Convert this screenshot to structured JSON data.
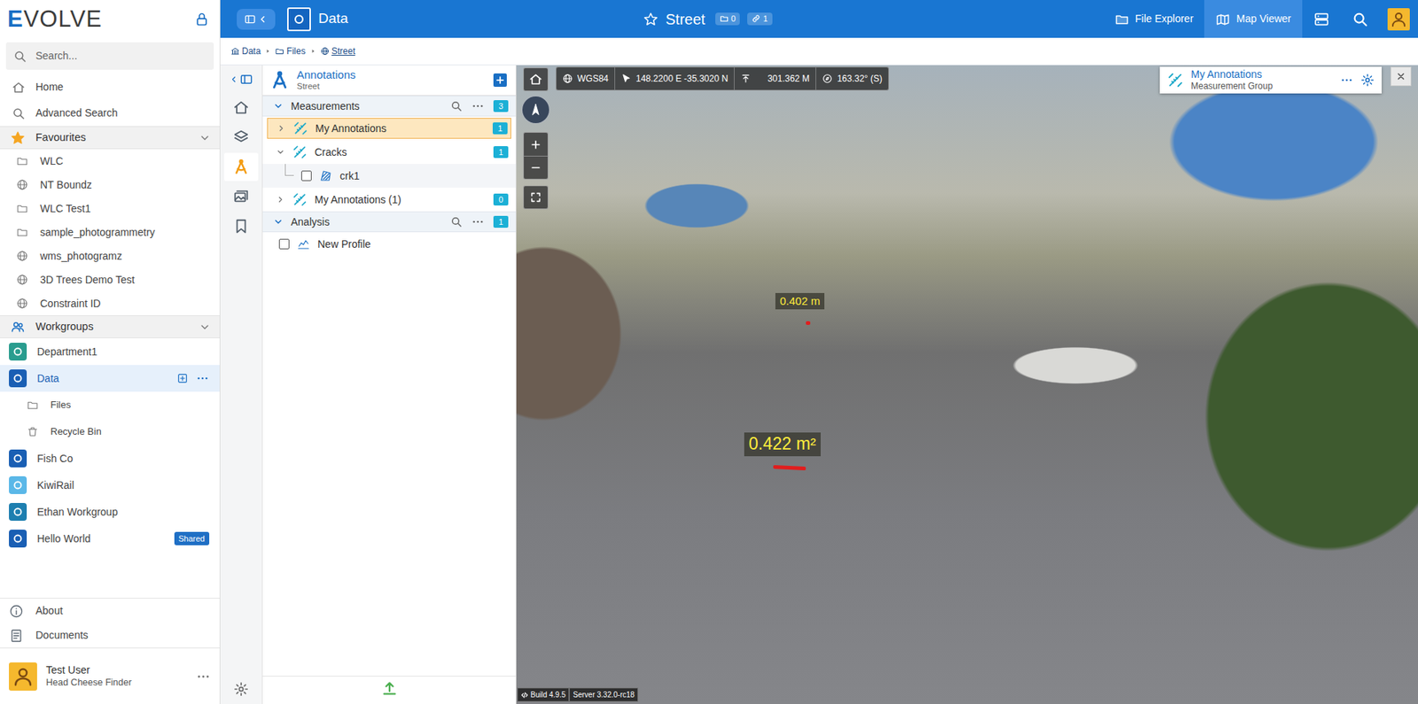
{
  "brand": {
    "logo": "EVOLVE"
  },
  "sidebar": {
    "search": {
      "placeholder": "Search..."
    },
    "nav": [
      {
        "label": "Home",
        "kind": "home"
      },
      {
        "label": "Advanced Search",
        "kind": "search"
      }
    ],
    "favourites": {
      "title": "Favourites",
      "expanded": true,
      "items": [
        {
          "label": "WLC",
          "kind": "folder"
        },
        {
          "label": "NT Boundz",
          "kind": "globe"
        },
        {
          "label": "WLC Test1",
          "kind": "folder"
        },
        {
          "label": "sample_photogrammetry",
          "kind": "folder"
        },
        {
          "label": "wms_photogramz",
          "kind": "globe"
        },
        {
          "label": "3D Trees Demo Test",
          "kind": "globe"
        },
        {
          "label": "Constraint ID",
          "kind": "globe"
        }
      ]
    },
    "workgroups": {
      "title": "Workgroups",
      "expanded": true,
      "items": [
        {
          "label": "Department1",
          "kind": "group",
          "color": "#2a9d8f",
          "selected": false
        },
        {
          "label": "Data",
          "kind": "group",
          "color": "#1a5fb4",
          "selected": true
        },
        {
          "label": "Files",
          "kind": "folder",
          "selected": false
        },
        {
          "label": "Recycle Bin",
          "kind": "bin",
          "selected": false
        },
        {
          "label": "Fish Co",
          "kind": "group",
          "color": "#1a5fb4",
          "selected": false
        },
        {
          "label": "KiwiRail",
          "kind": "group",
          "color": "#5bb8e8",
          "selected": false
        },
        {
          "label": "Ethan Workgroup",
          "kind": "group",
          "color": "#1e7fb0",
          "selected": false
        },
        {
          "label": "Hello World",
          "kind": "group",
          "color": "#1a5fb4",
          "selected": false,
          "badge": "Shared"
        }
      ]
    },
    "footer": [
      {
        "label": "About",
        "kind": "info"
      },
      {
        "label": "Documents",
        "kind": "document"
      }
    ],
    "user": {
      "name": "Test User",
      "role": "Head Cheese Finder"
    }
  },
  "topbar": {
    "workgroup": "Data",
    "title": "Street",
    "favourite": false,
    "badges": [
      {
        "kind": "folder",
        "value": "0"
      },
      {
        "kind": "link",
        "value": "1"
      }
    ],
    "views": [
      {
        "label": "File Explorer",
        "kind": "folder",
        "selected": false
      },
      {
        "label": "Map Viewer",
        "kind": "map",
        "selected": true
      }
    ]
  },
  "breadcrumb": [
    {
      "label": "Data",
      "kind": "workgroup",
      "selected": false
    },
    {
      "label": "Files",
      "kind": "folder",
      "selected": false
    },
    {
      "label": "Street",
      "kind": "globe",
      "selected": true
    }
  ],
  "rail": [
    {
      "kind": "home",
      "selected": false
    },
    {
      "kind": "layers",
      "selected": false
    },
    {
      "kind": "annotations",
      "selected": true
    },
    {
      "kind": "images",
      "selected": false
    },
    {
      "kind": "bookmarks",
      "selected": false
    }
  ],
  "panel": {
    "title": "Annotations",
    "subtitle": "Street",
    "sections": [
      {
        "title": "Measurements",
        "count": "3",
        "expanded": true,
        "items": [
          {
            "label": "My Annotations",
            "kind": "group",
            "count": "1",
            "expanded": false,
            "selected": true
          },
          {
            "label": "Cracks",
            "kind": "group",
            "count": "1",
            "expanded": true,
            "selected": false,
            "children": [
              {
                "label": "crk1",
                "kind": "polygon",
                "checked": false,
                "selected": false
              }
            ]
          },
          {
            "label": "My Annotations (1)",
            "kind": "group",
            "count": "0",
            "expanded": false,
            "selected": false
          }
        ]
      },
      {
        "title": "Analysis",
        "count": "1",
        "expanded": true,
        "items": [
          {
            "label": "New Profile",
            "kind": "profile",
            "checked": false,
            "selected": false
          }
        ]
      }
    ]
  },
  "map": {
    "toolbar": {
      "crs": "WGS84",
      "position": "148.2200 E -35.3020 N",
      "elevation": "301.362 M",
      "heading": "163.32° (S)"
    },
    "labels": [
      {
        "text": "0.402 m"
      },
      {
        "text": "0.422 m²"
      }
    ],
    "info": {
      "title": "My Annotations",
      "subtitle": "Measurement Group"
    },
    "status": [
      "Build 4.9.5",
      "Server 3.32.0-rc18"
    ]
  }
}
